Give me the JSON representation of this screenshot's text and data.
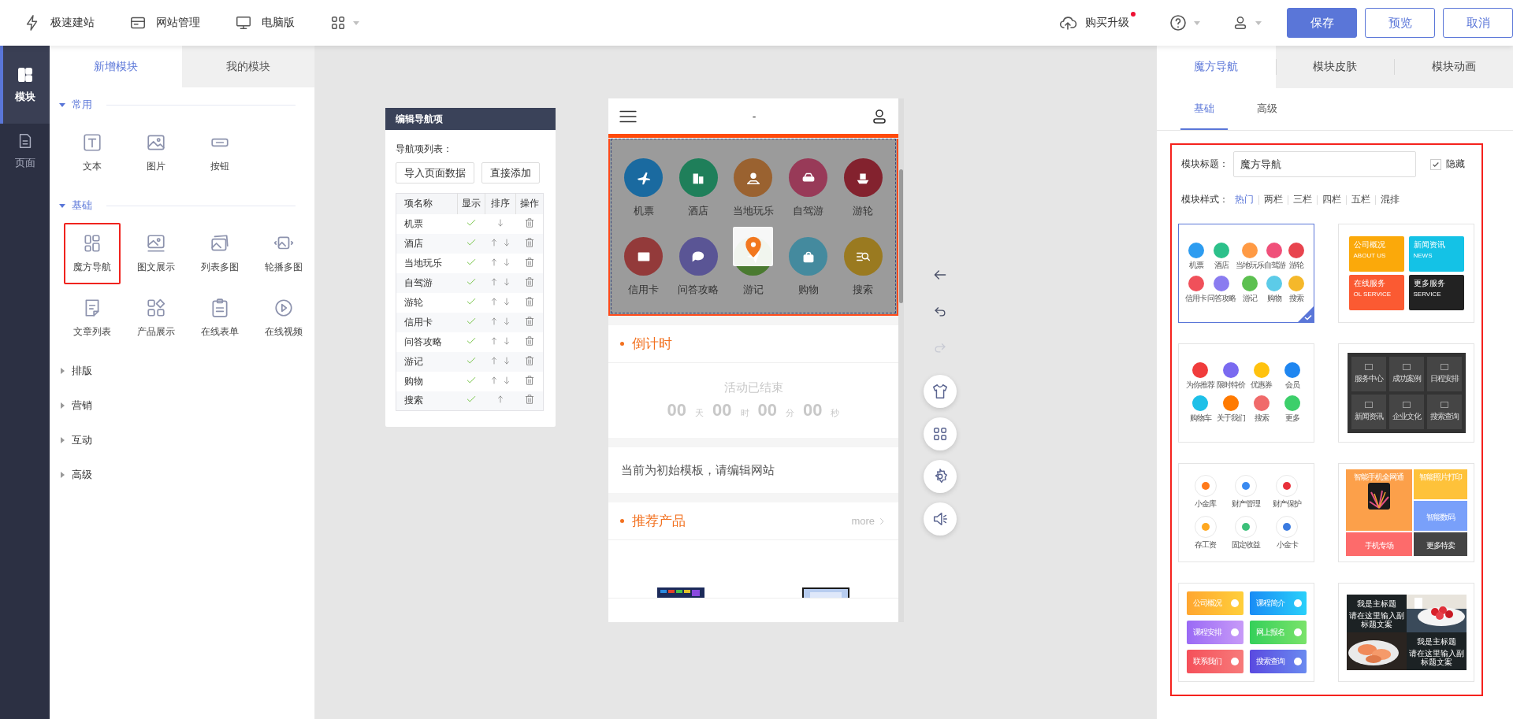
{
  "top_bar": {
    "links": [
      {
        "label": "极速建站"
      },
      {
        "label": "网站管理"
      },
      {
        "label": "电脑版"
      }
    ],
    "upgrade": {
      "label": "购买升级",
      "notification": true
    },
    "buttons": [
      {
        "label": "保存",
        "kind": "primary"
      },
      {
        "label": "预览",
        "kind": "outline"
      },
      {
        "label": "取消",
        "kind": "outline"
      }
    ]
  },
  "rail": [
    {
      "label": "模块",
      "selected": true
    },
    {
      "label": "页面",
      "selected": false
    }
  ],
  "module_panel": {
    "tabs": [
      {
        "label": "新增模块",
        "selected": true
      },
      {
        "label": "我的模块",
        "selected": false
      }
    ],
    "sections": [
      {
        "title": "常用",
        "expanded": true,
        "items": [
          {
            "label": "文本",
            "selected": false
          },
          {
            "label": "图片",
            "selected": false
          },
          {
            "label": "按钮",
            "selected": false
          }
        ]
      },
      {
        "title": "基础",
        "expanded": true,
        "items": [
          {
            "label": "魔方导航",
            "selected": true
          },
          {
            "label": "图文展示",
            "selected": false
          },
          {
            "label": "列表多图",
            "selected": false
          },
          {
            "label": "轮播多图",
            "selected": false
          },
          {
            "label": "文章列表",
            "selected": false
          },
          {
            "label": "产品展示",
            "selected": false
          },
          {
            "label": "在线表单",
            "selected": false
          },
          {
            "label": "在线视频",
            "selected": false
          }
        ]
      },
      {
        "title": "排版",
        "expanded": false
      },
      {
        "title": "营销",
        "expanded": false
      },
      {
        "title": "互动",
        "expanded": false
      },
      {
        "title": "高级",
        "expanded": false
      }
    ]
  },
  "nav_editor": {
    "title": "编辑导航项",
    "list_label": "导航项列表：",
    "buttons": [
      "导入页面数据",
      "直接添加"
    ],
    "columns": [
      "项名称",
      "显示",
      "排序",
      "操作"
    ],
    "rows": [
      {
        "name": "机票",
        "shown": true
      },
      {
        "name": "酒店",
        "shown": true
      },
      {
        "name": "当地玩乐",
        "shown": true
      },
      {
        "name": "自驾游",
        "shown": true
      },
      {
        "name": "游轮",
        "shown": true
      },
      {
        "name": "信用卡",
        "shown": true
      },
      {
        "name": "问答攻略",
        "shown": true
      },
      {
        "name": "游记",
        "shown": true
      },
      {
        "name": "购物",
        "shown": true
      },
      {
        "name": "搜索",
        "shown": true
      }
    ]
  },
  "phone": {
    "title": "-",
    "nav": [
      {
        "label": "机票",
        "color": "#1a6aa0"
      },
      {
        "label": "酒店",
        "color": "#1f7f5a"
      },
      {
        "label": "当地玩乐",
        "color": "#9a6230"
      },
      {
        "label": "自驾游",
        "color": "#983a58"
      },
      {
        "label": "游轮",
        "color": "#83222e"
      },
      {
        "label": "信用卡",
        "color": "#933a3a"
      },
      {
        "label": "问答攻略",
        "color": "#5a5595"
      },
      {
        "label": "游记",
        "color": "#4a7a30"
      },
      {
        "label": "购物",
        "color": "#448a9e"
      },
      {
        "label": "搜索",
        "color": "#9a7a20"
      }
    ],
    "countdown": {
      "title": "倒计时",
      "status": "活动已结束",
      "units": [
        {
          "value": "00",
          "unit": "天"
        },
        {
          "value": "00",
          "unit": "时"
        },
        {
          "value": "00",
          "unit": "分"
        },
        {
          "value": "00",
          "unit": "秒"
        }
      ]
    },
    "notice": "当前为初始模板，请编辑网站",
    "products": {
      "title": "推荐产品",
      "more": "more"
    }
  },
  "properties": {
    "tabs": [
      {
        "label": "魔方导航",
        "selected": true
      },
      {
        "label": "模块皮肤",
        "selected": false
      },
      {
        "label": "模块动画",
        "selected": false
      }
    ],
    "subtabs": [
      {
        "label": "基础",
        "selected": true
      },
      {
        "label": "高级",
        "selected": false
      }
    ],
    "title_label": "模块标题：",
    "title_value": "魔方导航",
    "hide": {
      "label": "隐藏",
      "checked": true
    },
    "style_label": "模块样式：",
    "style_tabs": [
      {
        "label": "热门",
        "selected": true
      },
      {
        "label": "两栏",
        "selected": false
      },
      {
        "label": "三栏",
        "selected": false
      },
      {
        "label": "四栏",
        "selected": false
      },
      {
        "label": "五栏",
        "selected": false
      },
      {
        "label": "混排",
        "selected": false
      }
    ],
    "styles": [
      {
        "kind": "icon-grid",
        "selected": true,
        "items": [
          "机票",
          "酒店",
          "当地玩乐",
          "自驾游",
          "游轮",
          "信用卡",
          "问答攻略",
          "游记",
          "购物",
          "搜索"
        ]
      },
      {
        "kind": "tiles",
        "selected": false,
        "items": [
          {
            "title": "公司概况",
            "subtitle": "ABOUT US"
          },
          {
            "title": "新闻资讯",
            "subtitle": "NEWS"
          },
          {
            "title": "在线服务",
            "subtitle": "OL SERVICE"
          },
          {
            "title": "更多服务",
            "subtitle": "SERVICE"
          }
        ]
      },
      {
        "kind": "icon-grid",
        "selected": false,
        "items": [
          "为你推荐",
          "限时特价",
          "优惠券",
          "会员",
          "购物车",
          "关于我们",
          "搜索",
          "更多"
        ]
      },
      {
        "kind": "dark-grid",
        "selected": false,
        "items": [
          "服务中心",
          "成功案例",
          "日程安排",
          "新闻资讯",
          "企业文化",
          "搜索查询"
        ]
      },
      {
        "kind": "outline",
        "selected": false,
        "items": [
          "小金库",
          "财产管理",
          "财产保护",
          "存工资",
          "固定收益",
          "小金卡"
        ]
      },
      {
        "kind": "promo",
        "selected": false,
        "items": [
          "智能手机全网通",
          "智能照片打印",
          "智能数码",
          "手机专场",
          "更多特卖"
        ]
      },
      {
        "kind": "gradient",
        "selected": false,
        "items": [
          "公司概况",
          "课程简介",
          "课程安排",
          "网上报名",
          "联系我们",
          "搜索查询"
        ]
      },
      {
        "kind": "banner",
        "selected": false,
        "items": [
          {
            "title": "我是主标题",
            "subtitle": "请在这里输入副标题文案"
          },
          {
            "title": "我是主标题",
            "subtitle": "请在这里输入副标题文案"
          }
        ]
      }
    ]
  }
}
